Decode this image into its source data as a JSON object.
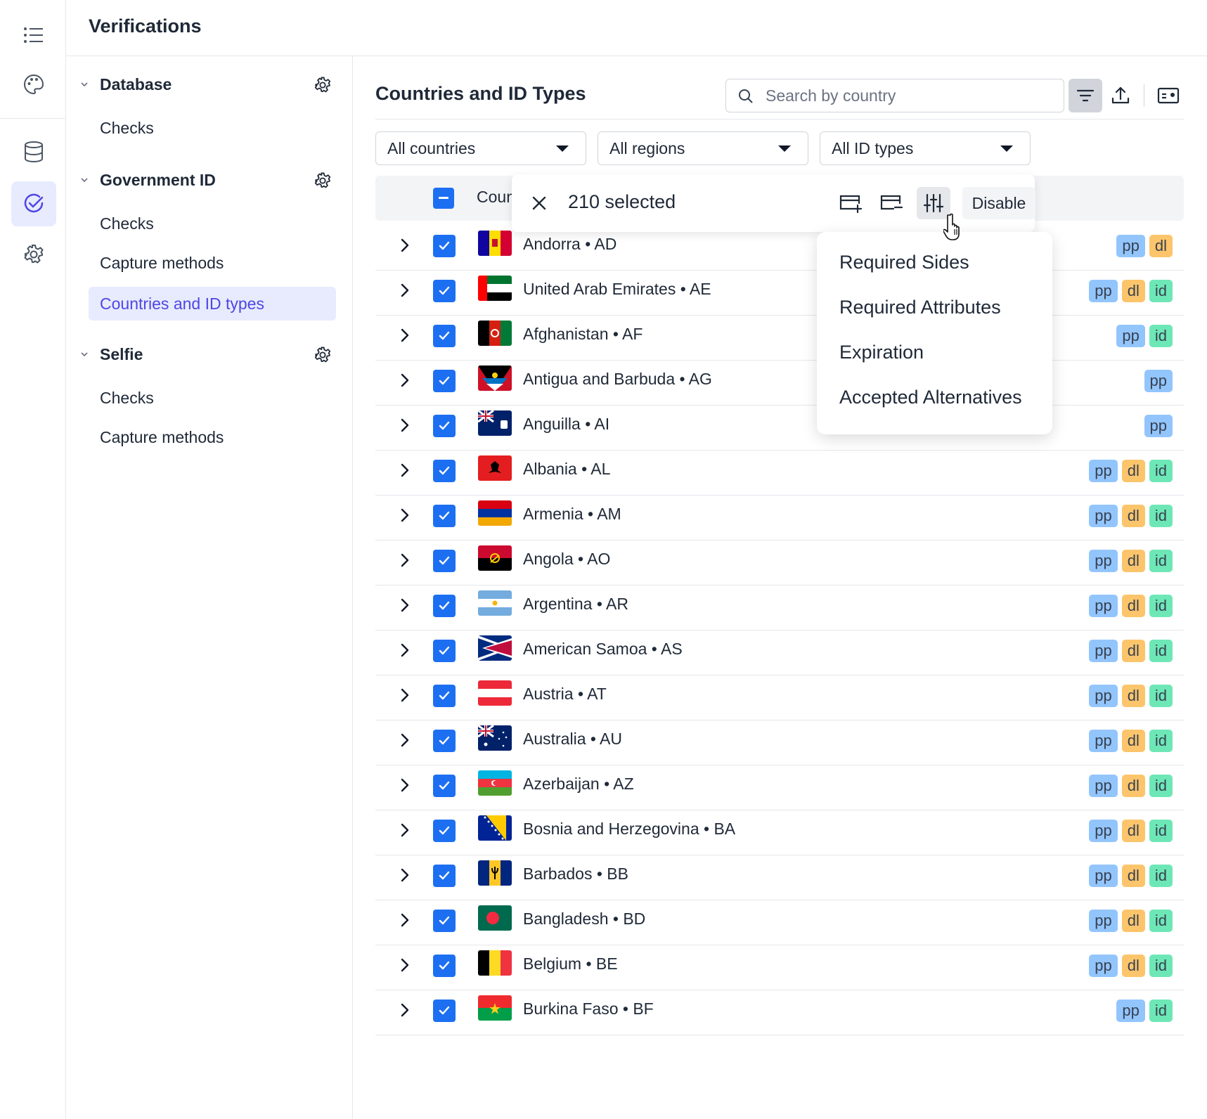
{
  "app": {
    "title": "Verifications"
  },
  "rail": {
    "items": [
      {
        "icon": "list-icon"
      },
      {
        "icon": "palette-icon"
      },
      {
        "icon": "database-icon"
      },
      {
        "icon": "check-circle-icon",
        "active": true
      },
      {
        "icon": "gear-icon"
      }
    ]
  },
  "nav": {
    "sections": [
      {
        "label": "Database",
        "items": [
          "Checks"
        ]
      },
      {
        "label": "Government ID",
        "items": [
          "Checks",
          "Capture methods",
          "Countries and ID types"
        ],
        "active_item": "Countries and ID types"
      },
      {
        "label": "Selfie",
        "items": [
          "Checks",
          "Capture methods"
        ]
      }
    ]
  },
  "main": {
    "title": "Countries and ID Types",
    "search": {
      "placeholder": "Search by country",
      "value": ""
    },
    "filters": {
      "countries": "All countries",
      "regions": "All regions",
      "id_types": "All ID types"
    },
    "table": {
      "header_country": "Country",
      "rows": [
        {
          "name": "Andorra • AD",
          "tags": [
            "pp",
            "dl"
          ]
        },
        {
          "name": "United Arab Emirates • AE",
          "tags": [
            "pp",
            "dl",
            "id"
          ]
        },
        {
          "name": "Afghanistan • AF",
          "tags": [
            "pp",
            "id"
          ]
        },
        {
          "name": "Antigua and Barbuda • AG",
          "tags": [
            "pp"
          ]
        },
        {
          "name": "Anguilla • AI",
          "tags": [
            "pp"
          ]
        },
        {
          "name": "Albania • AL",
          "tags": [
            "pp",
            "dl",
            "id"
          ]
        },
        {
          "name": "Armenia • AM",
          "tags": [
            "pp",
            "dl",
            "id"
          ]
        },
        {
          "name": "Angola • AO",
          "tags": [
            "pp",
            "dl",
            "id"
          ]
        },
        {
          "name": "Argentina • AR",
          "tags": [
            "pp",
            "dl",
            "id"
          ]
        },
        {
          "name": "American Samoa • AS",
          "tags": [
            "pp",
            "dl",
            "id"
          ]
        },
        {
          "name": "Austria • AT",
          "tags": [
            "pp",
            "dl",
            "id"
          ]
        },
        {
          "name": "Australia • AU",
          "tags": [
            "pp",
            "dl",
            "id"
          ]
        },
        {
          "name": "Azerbaijan • AZ",
          "tags": [
            "pp",
            "dl",
            "id"
          ]
        },
        {
          "name": "Bosnia and Herzegovina • BA",
          "tags": [
            "pp",
            "dl",
            "id"
          ]
        },
        {
          "name": "Barbados • BB",
          "tags": [
            "pp",
            "dl",
            "id"
          ]
        },
        {
          "name": "Bangladesh • BD",
          "tags": [
            "pp",
            "dl",
            "id"
          ]
        },
        {
          "name": "Belgium • BE",
          "tags": [
            "pp",
            "dl",
            "id"
          ]
        },
        {
          "name": "Burkina Faso • BF",
          "tags": [
            "pp",
            "id"
          ]
        }
      ]
    },
    "selection": {
      "count_label": "210 selected",
      "disable_label": "Disable",
      "menu": [
        "Required Sides",
        "Required Attributes",
        "Expiration",
        "Accepted Alternatives"
      ]
    }
  },
  "colors": {
    "accent": "#4f46e5",
    "checkbox": "#1d6ff2",
    "tag_pp": "#93c5fd",
    "tag_dl": "#fcc56b",
    "tag_id": "#6ee7b7"
  }
}
